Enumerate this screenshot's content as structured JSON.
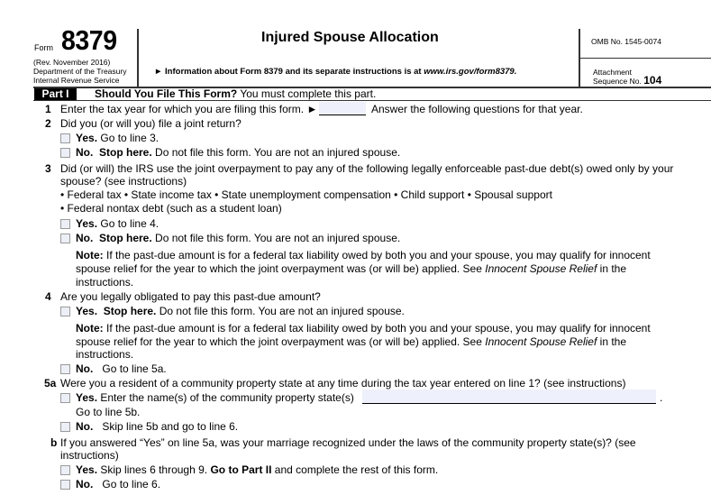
{
  "header": {
    "form_word": "Form",
    "form_number": "8379",
    "revision": "(Rev. November 2016)",
    "department": "Department of the Treasury",
    "agency": "Internal Revenue Service",
    "title": "Injured Spouse Allocation",
    "info_arrow": "►",
    "info_text": "Information about Form 8379 and its separate instructions is at ",
    "info_url": "www.irs.gov/form8379.",
    "omb": "OMB No. 1545-0074",
    "attachment_label": "Attachment",
    "sequence_label": "Sequence No.",
    "sequence_number": "104"
  },
  "part1": {
    "badge": "Part I",
    "title_bold": "Should You File This Form?",
    "title_rest": " You must complete this part."
  },
  "line1": {
    "num": "1",
    "text": "Enter the tax year for which you are filing this form. ►",
    "field_value": "",
    "after": "Answer the following questions for that year."
  },
  "line2": {
    "num": "2",
    "question": "Did you (or will you) file a joint return?",
    "yes_label": "Yes.",
    "yes_text": "Go to line 3.",
    "no_label": "No.",
    "no_bold": "Stop here.",
    "no_text": " Do not file this form. You are not an injured spouse."
  },
  "line3": {
    "num": "3",
    "question_l1": "Did (or will) the IRS use the joint overpayment to pay any of the following legally enforceable past-due debt(s) owed only by your",
    "question_l2": "spouse? (see instructions)",
    "bullets_l1": "• Federal tax • State income tax • State unemployment compensation • Child support • Spousal support",
    "bullets_l2": "• Federal nontax debt (such as a student loan)",
    "yes_label": "Yes.",
    "yes_text": "Go to line 4.",
    "no_label": "No.",
    "no_bold": "Stop here.",
    "no_text": " Do not file this form. You are not an injured spouse.",
    "note_label": "Note:",
    "note_l1": " If the past-due amount is for a federal tax liability owed by both you and your spouse, you may qualify for innocent",
    "note_l2a": "spouse relief for the year to which the joint overpayment was (or will be) applied. See ",
    "note_l2_italic": "Innocent Spouse Relief",
    "note_l2b": " in the",
    "note_l3": "instructions."
  },
  "line4": {
    "num": "4",
    "question": "Are you legally obligated to pay this past-due amount?",
    "yes_label": "Yes.",
    "yes_bold": "Stop here.",
    "yes_text": " Do not file this form. You are not an injured spouse.",
    "note_label": "Note:",
    "note_l1": " If the past-due amount is for a federal tax liability owed by both you and your spouse, you may qualify for innocent",
    "note_l2a": "spouse relief for the year to which the joint overpayment was (or will be) applied. See ",
    "note_l2_italic": "Innocent Spouse Relief",
    "note_l2b": " in the",
    "note_l3": "instructions.",
    "no_label": "No.",
    "no_text": "Go to line 5a."
  },
  "line5a": {
    "num": "5a",
    "question": "Were you a resident of a community property state at any time during the tax year entered on line 1? (see instructions)",
    "yes_label": "Yes.",
    "yes_text": "Enter the name(s) of the community property state(s)",
    "field_value": "",
    "period": ".",
    "yes_text2": "Go to line 5b.",
    "no_label": "No.",
    "no_text": "Skip line 5b and go to line 6."
  },
  "line5b": {
    "num": "b",
    "question_l1": "If you answered “Yes” on line 5a, was your marriage recognized under the laws of the community property state(s)? (see",
    "question_l2": "instructions)",
    "yes_label": "Yes.",
    "yes_text_a": "Skip lines 6 through 9. ",
    "yes_bold": "Go to Part II",
    "yes_text_b": " and complete the rest of this form.",
    "no_label": "No.",
    "no_text": "Go to line 6."
  }
}
